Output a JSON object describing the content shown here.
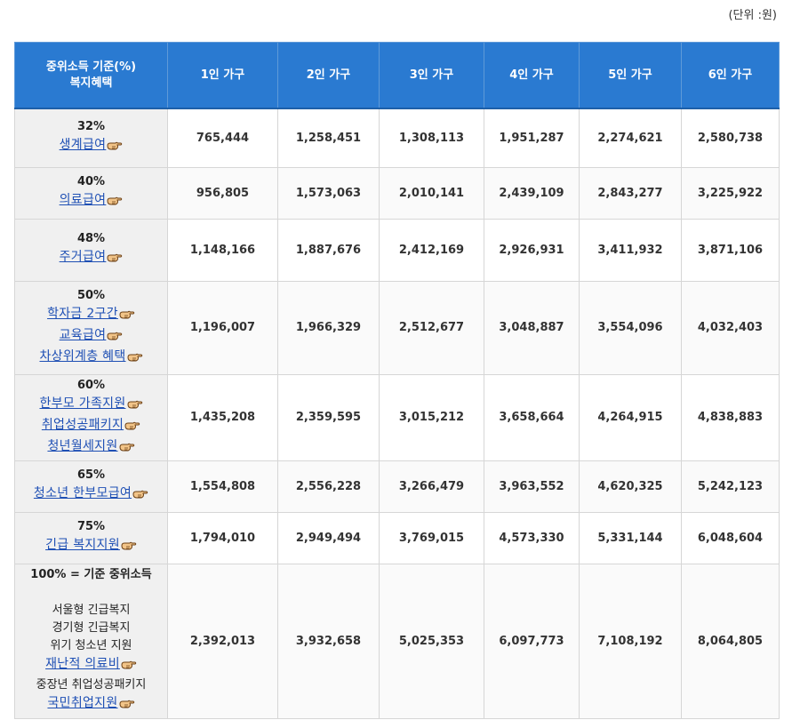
{
  "unit_note": "(단위 :원)",
  "header": {
    "corner": "중위소득 기준(%)\n복지혜택",
    "columns": [
      "1인 가구",
      "2인 가구",
      "3인 가구",
      "4인 가구",
      "5인 가구",
      "6인 가구"
    ]
  },
  "rows": [
    {
      "percent": "32%",
      "benefits": [
        "생계급여"
      ],
      "values": [
        "765,444",
        "1,258,451",
        "1,308,113",
        "1,951,287",
        "2,274,621",
        "2,580,738"
      ]
    },
    {
      "percent": "40%",
      "benefits": [
        "의료급여"
      ],
      "values": [
        "956,805",
        "1,573,063",
        "2,010,141",
        "2,439,109",
        "2,843,277",
        "3,225,922"
      ]
    },
    {
      "percent": "48%",
      "benefits": [
        "주거급여"
      ],
      "values": [
        "1,148,166",
        "1,887,676",
        "2,412,169",
        "2,926,931",
        "3,411,932",
        "3,871,106"
      ]
    },
    {
      "percent": "50%",
      "benefits": [
        "학자금 2구간",
        "교육급여",
        "차상위계층 혜택"
      ],
      "values": [
        "1,196,007",
        "1,966,329",
        "2,512,677",
        "3,048,887",
        "3,554,096",
        "4,032,403"
      ]
    },
    {
      "percent": "60%",
      "benefits": [
        "한부모 가족지원",
        "취업성공패키지",
        "청년월세지원"
      ],
      "values": [
        "1,435,208",
        "2,359,595",
        "3,015,212",
        "3,658,664",
        "4,264,915",
        "4,838,883"
      ]
    },
    {
      "percent": "65%",
      "benefits": [
        "청소년 한부모급여"
      ],
      "values": [
        "1,554,808",
        "2,556,228",
        "3,266,479",
        "3,963,552",
        "4,620,325",
        "5,242,123"
      ]
    },
    {
      "percent": "75%",
      "benefits": [
        "긴급 복지지원"
      ],
      "values": [
        "1,794,010",
        "2,949,494",
        "3,769,015",
        "4,573,330",
        "5,331,144",
        "6,048,604"
      ]
    },
    {
      "percent": "100% = 기준 중위소득",
      "items": [
        {
          "text": "서울형 긴급복지",
          "link": false
        },
        {
          "text": "경기형 긴급복지",
          "link": false
        },
        {
          "text": "위기 청소년 지원",
          "link": false
        },
        {
          "text": "재난적 의료비",
          "link": true
        },
        {
          "text": "중장년 취업성공패키지",
          "link": false
        },
        {
          "text": "국민취업지원",
          "link": true
        }
      ],
      "values": [
        "2,392,013",
        "3,932,658",
        "5,025,353",
        "6,097,773",
        "7,108,192",
        "8,064,805"
      ]
    }
  ],
  "icons": {
    "link_hint": "pointing-hand-icon"
  },
  "colors": {
    "header_bg": "#2a7ad1",
    "label_bg": "#f0f0f0",
    "link": "#1e4fb4",
    "hand": "#e8b46a"
  }
}
